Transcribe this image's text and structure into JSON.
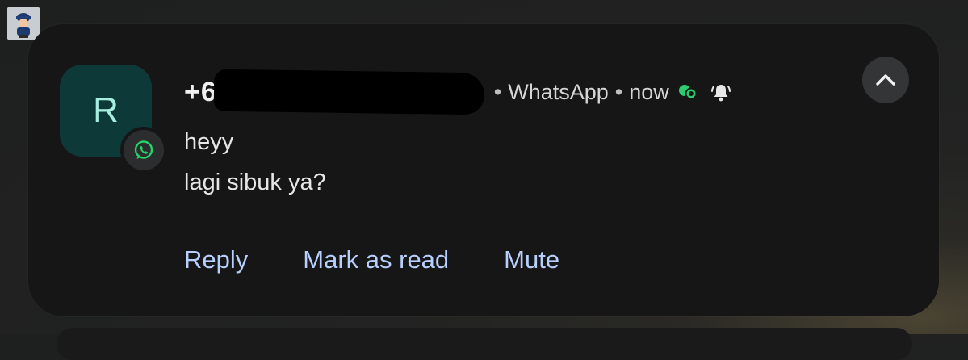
{
  "notification": {
    "avatar_letter": "R",
    "sender_prefix": "+6",
    "app_name": "WhatsApp",
    "time": "now",
    "separator": "•",
    "messages": [
      "heyy",
      "lagi sibuk ya?"
    ],
    "actions": {
      "reply": "Reply",
      "mark_as_read": "Mark as read",
      "mute": "Mute"
    }
  },
  "icons": {
    "app_badge": "whatsapp-icon",
    "status": "chat-bubbles-icon",
    "alert": "bell-ringing-icon",
    "collapse": "chevron-up-icon",
    "corner_app": "app-icon"
  },
  "colors": {
    "accent_action": "#b7cffc",
    "avatar_bg": "#0d3a38",
    "avatar_text": "#a8eee0",
    "whatsapp_green": "#25d366"
  }
}
